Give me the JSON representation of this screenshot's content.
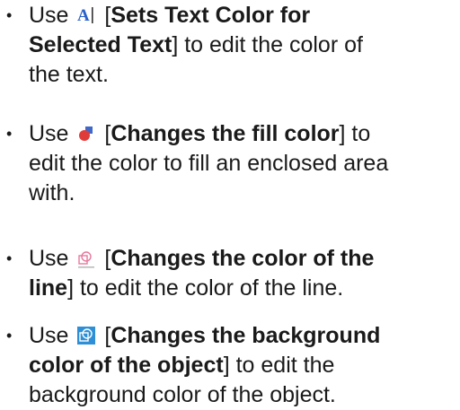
{
  "items": [
    {
      "use": "Use",
      "icon": "text-color-icon",
      "open": "[",
      "title_a": "Sets Text Color for",
      "title_b": "Selected Text",
      "close": "]",
      "rest_a": " to edit the color of",
      "rest_b": "the text."
    },
    {
      "use": "Use",
      "icon": "fill-color-icon",
      "open": "[",
      "title": "Changes the fill color",
      "close": "]",
      "rest_a": " to",
      "rest_b": "edit the color to fill an enclosed area",
      "rest_c": "with."
    },
    {
      "use": "Use",
      "icon": "line-color-icon",
      "open": "[",
      "title_a": "Changes the color of the",
      "title_b": "line",
      "close": "]",
      "rest_a": " to edit the color of the line."
    },
    {
      "use": "Use",
      "icon": "background-color-icon",
      "open": "[",
      "title_a": "Changes the background",
      "title_b": "color of the object",
      "close": "]",
      "rest_a": "  to edit the",
      "rest_b": "background color of the object."
    }
  ],
  "bullet": "•",
  "colors": {
    "text": "#1a1a1a",
    "text_icon_blue": "#2b62c9",
    "fill_icon_red": "#e03b3b",
    "fill_icon_blue": "#3f68c8",
    "line_icon_pink": "#e6799e",
    "bg_icon_blue": "#2f8fd6"
  }
}
